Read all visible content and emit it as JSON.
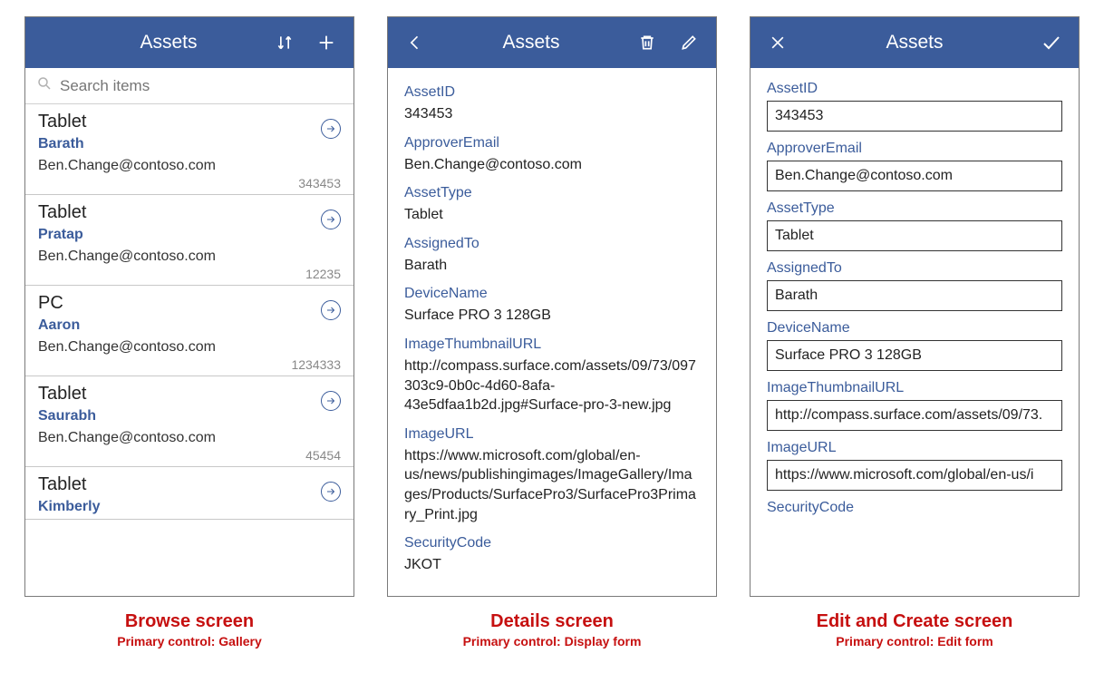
{
  "browse": {
    "title": "Assets",
    "search_placeholder": "Search items",
    "items": [
      {
        "type": "Tablet",
        "assigned": "Barath",
        "email": "Ben.Change@contoso.com",
        "id": "343453"
      },
      {
        "type": "Tablet",
        "assigned": "Pratap",
        "email": "Ben.Change@contoso.com",
        "id": "12235"
      },
      {
        "type": "PC",
        "assigned": "Aaron",
        "email": "Ben.Change@contoso.com",
        "id": "1234333"
      },
      {
        "type": "Tablet",
        "assigned": "Saurabh",
        "email": "Ben.Change@contoso.com",
        "id": "45454"
      },
      {
        "type": "Tablet",
        "assigned": "Kimberly",
        "email": "",
        "id": ""
      }
    ],
    "caption_title": "Browse screen",
    "caption_sub": "Primary control: Gallery"
  },
  "details": {
    "title": "Assets",
    "fields": {
      "asset_id_label": "AssetID",
      "asset_id": "343453",
      "approver_label": "ApproverEmail",
      "approver": "Ben.Change@contoso.com",
      "asset_type_label": "AssetType",
      "asset_type": "Tablet",
      "assigned_to_label": "AssignedTo",
      "assigned_to": "Barath",
      "device_name_label": "DeviceName",
      "device_name": "Surface PRO 3 128GB",
      "thumb_label": "ImageThumbnailURL",
      "thumb": "http://compass.surface.com/assets/09/73/097303c9-0b0c-4d60-8afa-43e5dfaa1b2d.jpg#Surface-pro-3-new.jpg",
      "imgurl_label": "ImageURL",
      "imgurl": "https://www.microsoft.com/global/en-us/news/publishingimages/ImageGallery/Images/Products/SurfacePro3/SurfacePro3Primary_Print.jpg",
      "seccode_label": "SecurityCode",
      "seccode": "JKOT"
    },
    "caption_title": "Details screen",
    "caption_sub": "Primary control: Display form"
  },
  "edit": {
    "title": "Assets",
    "fields": {
      "asset_id_label": "AssetID",
      "asset_id": "343453",
      "approver_label": "ApproverEmail",
      "approver": "Ben.Change@contoso.com",
      "asset_type_label": "AssetType",
      "asset_type": "Tablet",
      "assigned_to_label": "AssignedTo",
      "assigned_to": "Barath",
      "device_name_label": "DeviceName",
      "device_name": "Surface PRO 3 128GB",
      "thumb_label": "ImageThumbnailURL",
      "thumb": "http://compass.surface.com/assets/09/73.",
      "imgurl_label": "ImageURL",
      "imgurl": "https://www.microsoft.com/global/en-us/i",
      "seccode_label": "SecurityCode"
    },
    "caption_title": "Edit and Create screen",
    "caption_sub": "Primary control: Edit form"
  }
}
